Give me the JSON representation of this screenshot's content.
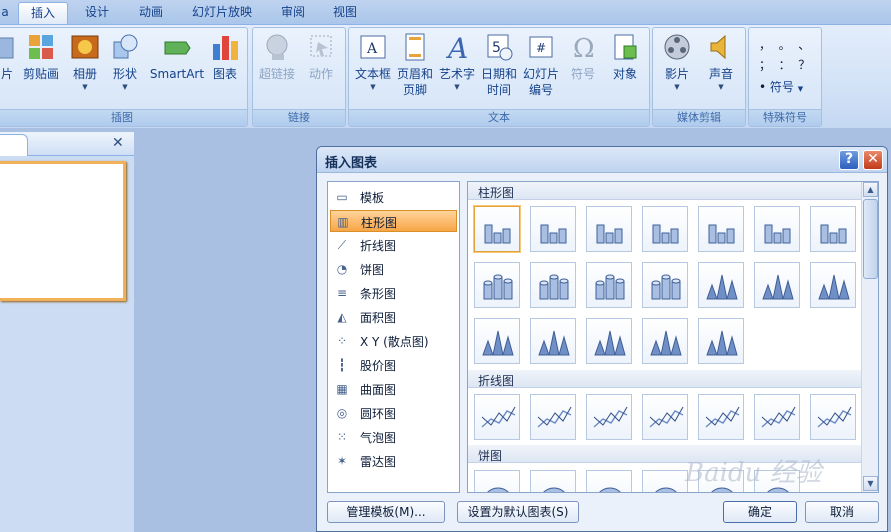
{
  "tabs": {
    "first_fragment": "a",
    "insert": "插入",
    "design": "设计",
    "animation": "动画",
    "slideshow": "幻灯片放映",
    "review": "审阅",
    "view": "视图"
  },
  "ribbon": {
    "illustrations": {
      "label": "插图",
      "partial_picture": "片",
      "clipart": "剪贴画",
      "album": "相册",
      "shapes": "形状",
      "smartart": "SmartArt",
      "chart": "图表"
    },
    "links": {
      "label": "链接",
      "hyperlink": "超链接",
      "action": "动作"
    },
    "text": {
      "label": "文本",
      "textbox": "文本框",
      "header_footer_1": "页眉和",
      "header_footer_2": "页脚",
      "wordart": "艺术字",
      "datetime_1": "日期和",
      "datetime_2": "时间",
      "slidenum_1": "幻灯片",
      "slidenum_2": "编号",
      "symbol": "符号",
      "object": "对象"
    },
    "media": {
      "label": "媒体剪辑",
      "movie": "影片",
      "sound": "声音"
    },
    "special": {
      "label": "特殊符号",
      "symbol": "符号",
      "glyphs_row1": "，  。  、",
      "glyphs_row2": "；  ：  ？",
      "glyph_dot": "•"
    }
  },
  "dialog": {
    "title": "插入图表",
    "help": "?",
    "close": "✕",
    "chart_types": [
      {
        "label": "模板",
        "icon": "folder-icon"
      },
      {
        "label": "柱形图",
        "icon": "column-chart-icon"
      },
      {
        "label": "折线图",
        "icon": "line-chart-icon"
      },
      {
        "label": "饼图",
        "icon": "pie-chart-icon"
      },
      {
        "label": "条形图",
        "icon": "bar-chart-icon"
      },
      {
        "label": "面积图",
        "icon": "area-chart-icon"
      },
      {
        "label": "X Y (散点图)",
        "icon": "scatter-chart-icon"
      },
      {
        "label": "股价图",
        "icon": "stock-chart-icon"
      },
      {
        "label": "曲面图",
        "icon": "surface-chart-icon"
      },
      {
        "label": "圆环图",
        "icon": "doughnut-chart-icon"
      },
      {
        "label": "气泡图",
        "icon": "bubble-chart-icon"
      },
      {
        "label": "雷达图",
        "icon": "radar-chart-icon"
      }
    ],
    "selected_type": "柱形图",
    "sections": {
      "column": "柱形图",
      "line": "折线图",
      "pie": "饼图"
    },
    "manage_templates": "管理模板(M)...",
    "set_default": "设置为默认图表(S)",
    "ok": "确定",
    "cancel": "取消"
  },
  "panel": {
    "close": "✕"
  },
  "watermark": "Baidu 经验"
}
